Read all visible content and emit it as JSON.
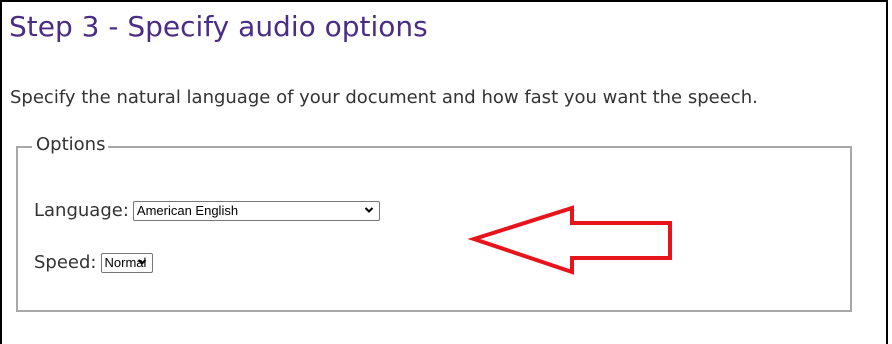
{
  "page": {
    "title": "Step 3 - Specify audio options",
    "intro": "Specify the natural language of your document and how fast you want the speech."
  },
  "options": {
    "legend": "Options",
    "language": {
      "label": "Language:",
      "selected": "American English"
    },
    "speed": {
      "label": "Speed:",
      "selected": "Normal"
    }
  },
  "annotation": {
    "shape": "arrow-left",
    "color": "#e8141c"
  },
  "colors": {
    "title": "#4b2d85",
    "text": "#333333",
    "fieldset_border": "#a8a8a8"
  },
  "icons": {
    "select_chevron": "chevron-down-icon"
  }
}
